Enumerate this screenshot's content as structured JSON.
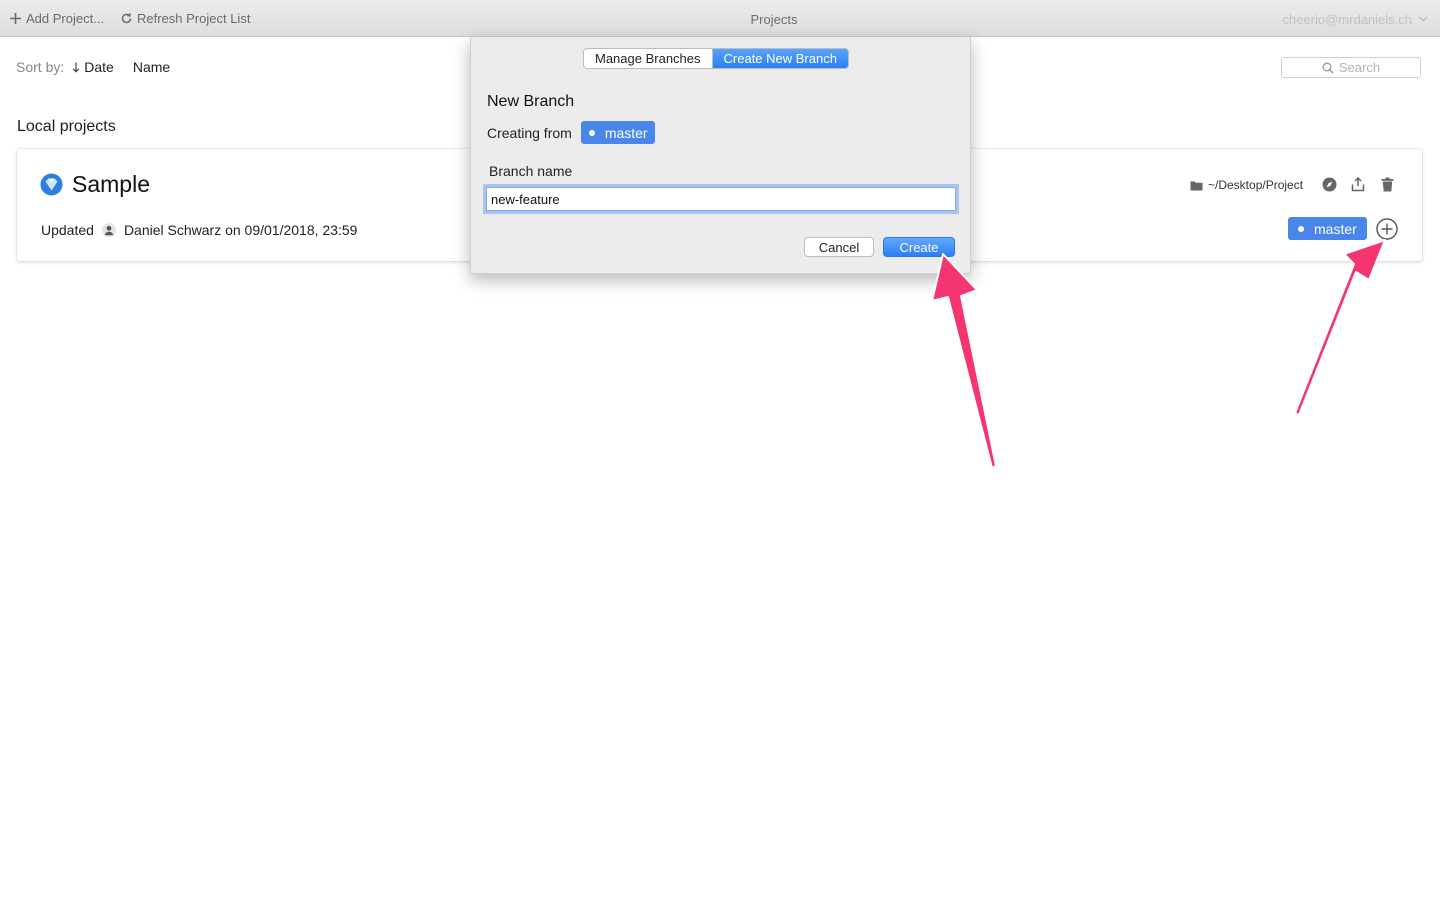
{
  "toolbar": {
    "add_project": "Add Project...",
    "refresh": "Refresh Project List",
    "title": "Projects",
    "user": "cheerio@mrdaniels.ch"
  },
  "sort": {
    "label": "Sort by:",
    "options": [
      {
        "label": "Date",
        "active": true
      },
      {
        "label": "Name",
        "active": false
      }
    ]
  },
  "search": {
    "placeholder": "Search"
  },
  "section": {
    "title": "Local projects"
  },
  "project": {
    "name": "Sample",
    "updated_label": "Updated",
    "updated_text": "Daniel Schwarz on 09/01/2018, 23:59",
    "path": "~/Desktop/Project",
    "branch": "master"
  },
  "dialog": {
    "tabs": [
      {
        "label": "Manage Branches",
        "active": false
      },
      {
        "label": "Create New Branch",
        "active": true
      }
    ],
    "heading": "New Branch",
    "creating_from_label": "Creating from",
    "source_branch": "master",
    "field_label": "Branch name",
    "field_value": "new-feature",
    "cancel_label": "Cancel",
    "create_label": "Create"
  },
  "colors": {
    "accent": "#4a85ea",
    "annotation_arrow": "#f4356f"
  }
}
